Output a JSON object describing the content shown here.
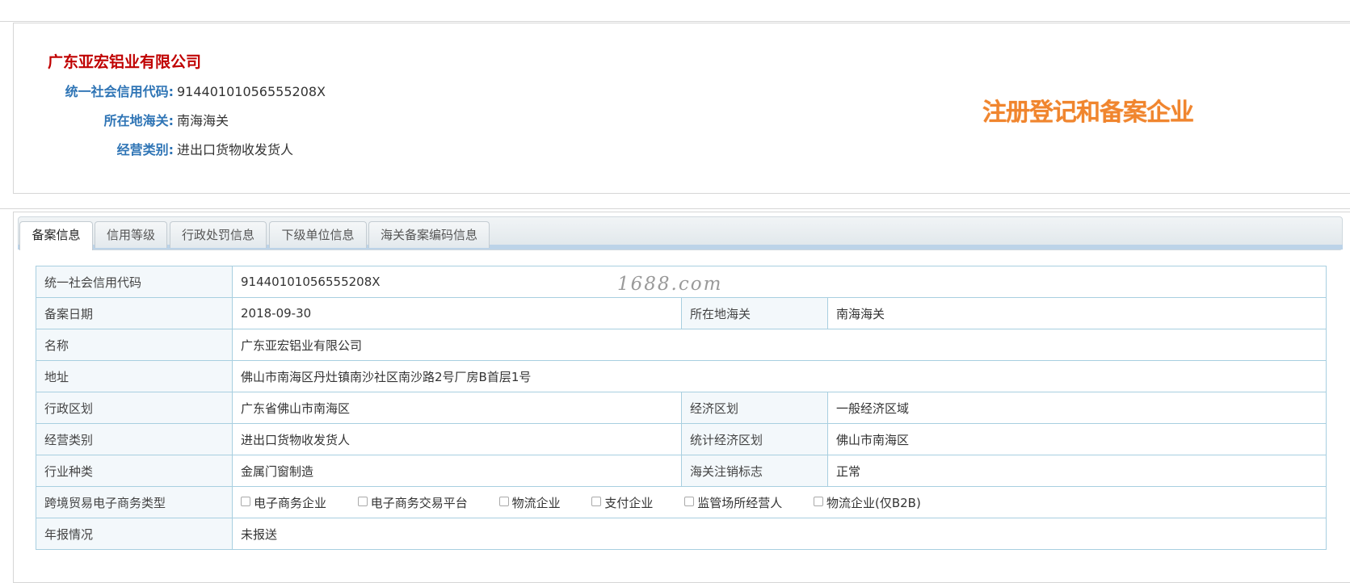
{
  "company": {
    "name": "广东亚宏铝业有限公司",
    "fields": [
      {
        "label": "统一社会信用代码:",
        "value": "91440101056555208X"
      },
      {
        "label": "所在地海关:",
        "value": "南海海关"
      },
      {
        "label": "经营类别:",
        "value": "进出口货物收发货人"
      }
    ],
    "stamp": "注册登记和备案企业"
  },
  "tabs": [
    "备案信息",
    "信用等级",
    "行政处罚信息",
    "下级单位信息",
    "海关备案编码信息"
  ],
  "active_tab": "备案信息",
  "watermark": "1688.com",
  "table": {
    "credit_code": {
      "label": "统一社会信用代码",
      "value": "91440101056555208X"
    },
    "record_date": {
      "label": "备案日期",
      "value": "2018-09-30"
    },
    "customs": {
      "label": "所在地海关",
      "value": "南海海关"
    },
    "name": {
      "label": "名称",
      "value": "广东亚宏铝业有限公司"
    },
    "address": {
      "label": "地址",
      "value": "佛山市南海区丹灶镇南沙社区南沙路2号厂房B首层1号"
    },
    "admin_region": {
      "label": "行政区划",
      "value": "广东省佛山市南海区"
    },
    "econ_region": {
      "label": "经济区划",
      "value": "一般经济区域"
    },
    "business_type": {
      "label": "经营类别",
      "value": "进出口货物收发货人"
    },
    "stat_region": {
      "label": "统计经济区划",
      "value": "佛山市南海区"
    },
    "industry": {
      "label": "行业种类",
      "value": "金属门窗制造"
    },
    "cancel_flag": {
      "label": "海关注销标志",
      "value": "正常"
    },
    "ecommerce": {
      "label": "跨境贸易电子商务类型",
      "options": [
        "电子商务企业",
        "电子商务交易平台",
        "物流企业",
        "支付企业",
        "监管场所经营人",
        "物流企业(仅B2B)"
      ]
    },
    "annual_report": {
      "label": "年报情况",
      "value": "未报送"
    }
  },
  "colors": {
    "company_name": "#c00000",
    "field_label": "#2e74b5",
    "stamp": "#f0852e",
    "table_border": "#a8cfe0"
  }
}
